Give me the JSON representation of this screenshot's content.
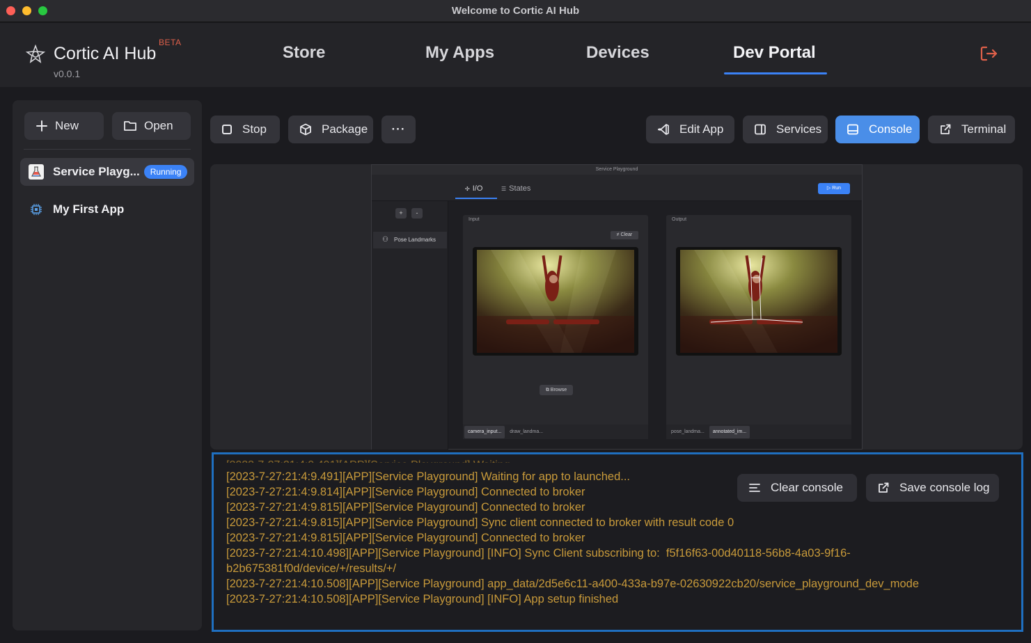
{
  "window": {
    "title": "Welcome to Cortic AI Hub"
  },
  "header": {
    "brand": "Cortic AI Hub",
    "beta": "BETA",
    "version": "v0.0.1",
    "nav": [
      "Store",
      "My Apps",
      "Devices",
      "Dev Portal"
    ],
    "active_nav": "Dev Portal",
    "logout_icon": "logout-icon"
  },
  "sidebar": {
    "new_label": "New",
    "open_label": "Open",
    "apps": [
      {
        "name": "Service Playg...",
        "status": "Running",
        "icon": "flask-icon",
        "selected": true
      },
      {
        "name": "My First App",
        "status": "",
        "icon": "chip-icon",
        "selected": false
      }
    ]
  },
  "toolbar": {
    "stop_label": "Stop",
    "package_label": "Package",
    "more_label": "···",
    "edit_app_label": "Edit App",
    "services_label": "Services",
    "console_label": "Console",
    "terminal_label": "Terminal",
    "active": "Console"
  },
  "preview": {
    "title": "Service Playground",
    "tab_io": "I/O",
    "tab_states": "States",
    "run_label": "Run",
    "plus": "+",
    "minus": "-",
    "service_item": "Pose Landmarks",
    "input_label": "Input",
    "output_label": "Output",
    "clear_label": "Clear",
    "browse_label": "Browse",
    "input_tabs": [
      "camera_input...",
      "draw_landma..."
    ],
    "output_tabs": [
      "pose_landma...",
      "annotated_im..."
    ]
  },
  "console": {
    "clear_label": "Clear console",
    "save_label": "Save console log",
    "text_color": "#c89a3a",
    "border_color": "#1f6fc0",
    "lines": [
      "[2023-7-27:21:4:9.491][APP][Service Playground] Waiting for app to launched...",
      "[2023-7-27:21:4:9.814][APP][Service Playground] Connected to broker",
      "[2023-7-27:21:4:9.815][APP][Service Playground] Connected to broker",
      "[2023-7-27:21:4:9.815][APP][Service Playground] Sync client connected to broker with result code 0",
      "[2023-7-27:21:4:9.815][APP][Service Playground] Connected to broker",
      "[2023-7-27:21:4:10.498][APP][Service Playground] [INFO] Sync Client subscribing to:  f5f16f63-00d40118-56b8-4a03-9f16-b2b675381f0d/device/+/results/+/",
      "[2023-7-27:21:4:10.508][APP][Service Playground] app_data/2d5e6c11-a400-433a-b97e-02630922cb20/service_playground_dev_mode",
      "[2023-7-27:21:4:10.508][APP][Service Playground] [INFO] App setup finished"
    ]
  },
  "colors": {
    "accent": "#3b82f6",
    "background": "#1b1b1f",
    "panel": "#26262a",
    "logout": "#e0604a"
  }
}
